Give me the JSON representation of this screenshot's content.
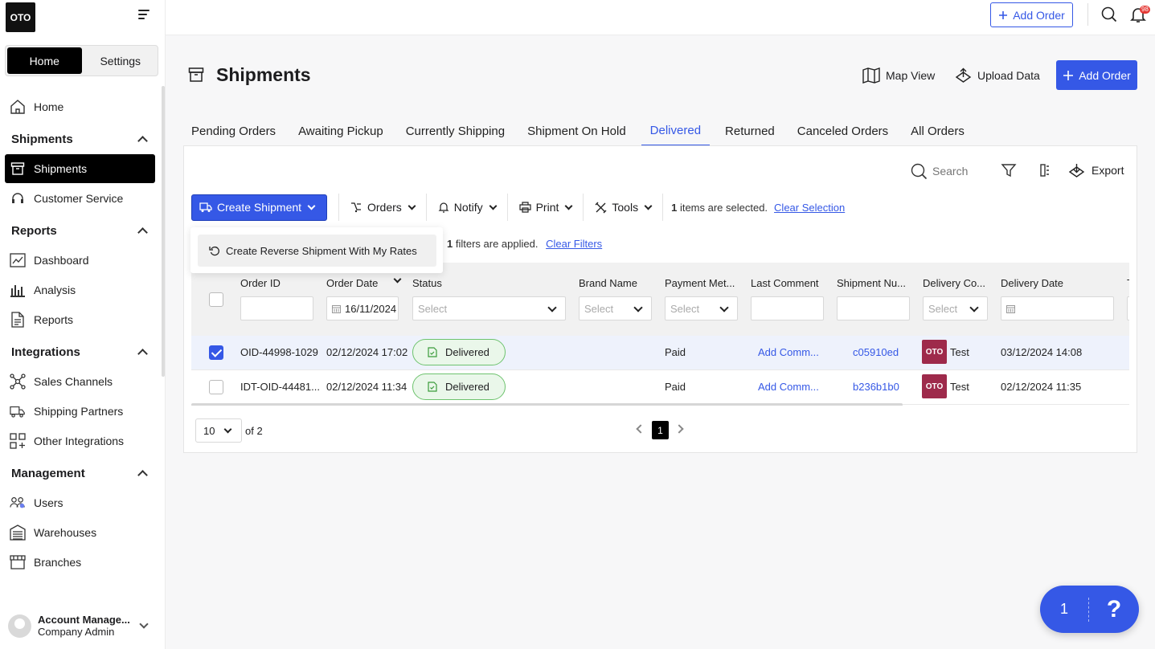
{
  "app": {
    "logo_text": "OTO"
  },
  "sidebar": {
    "segment": {
      "home": "Home",
      "settings": "Settings"
    },
    "items": [
      {
        "type": "item",
        "label": "Home",
        "icon": "house-icon"
      },
      {
        "type": "head",
        "label": "Shipments"
      },
      {
        "type": "item",
        "label": "Shipments",
        "icon": "box-icon",
        "active": true
      },
      {
        "type": "item",
        "label": "Customer Service",
        "icon": "headset-icon"
      },
      {
        "type": "head",
        "label": "Reports"
      },
      {
        "type": "item",
        "label": "Dashboard",
        "icon": "dashboard-icon"
      },
      {
        "type": "item",
        "label": "Analysis",
        "icon": "bar-chart-icon"
      },
      {
        "type": "item",
        "label": "Reports",
        "icon": "document-icon"
      },
      {
        "type": "head",
        "label": "Integrations"
      },
      {
        "type": "item",
        "label": "Sales Channels",
        "icon": "network-icon"
      },
      {
        "type": "item",
        "label": "Shipping Partners",
        "icon": "truck-icon"
      },
      {
        "type": "item",
        "label": "Other Integrations",
        "icon": "grid-plus-icon"
      },
      {
        "type": "head",
        "label": "Management"
      },
      {
        "type": "item",
        "label": "Users",
        "icon": "users-icon"
      },
      {
        "type": "item",
        "label": "Warehouses",
        "icon": "warehouse-icon"
      },
      {
        "type": "item",
        "label": "Branches",
        "icon": "store-icon"
      }
    ],
    "account": {
      "name": "Account Manage...",
      "role": "Company Admin"
    }
  },
  "topbar": {
    "add_order": "Add Order",
    "notification_count": "98"
  },
  "page": {
    "title": "Shipments",
    "map_view": "Map View",
    "upload_data": "Upload Data",
    "add_order": "Add Order"
  },
  "tabs": [
    {
      "label": "Pending Orders"
    },
    {
      "label": "Awaiting Pickup"
    },
    {
      "label": "Currently Shipping"
    },
    {
      "label": "Shipment On Hold"
    },
    {
      "label": "Delivered",
      "active": true
    },
    {
      "label": "Returned"
    },
    {
      "label": "Canceled Orders"
    },
    {
      "label": "All Orders"
    }
  ],
  "card": {
    "search_placeholder": "Search",
    "export": "Export",
    "toolbar": {
      "create_shipment": "Create Shipment",
      "orders": "Orders",
      "notify": "Notify",
      "print": "Print",
      "tools": "Tools",
      "selected_count": "1",
      "selected_text": "items are selected.",
      "clear_selection": "Clear Selection"
    },
    "dropdown_item": "Create Reverse Shipment With My Rates",
    "filters_count": "1",
    "filters_text": "filters are applied.",
    "clear_filters": "Clear Filters"
  },
  "table": {
    "columns": [
      "Order ID",
      "Order Date",
      "Status",
      "Brand Name",
      "Payment Met...",
      "Last Comment",
      "Shipment Nu...",
      "Delivery Co...",
      "Delivery Date",
      "T"
    ],
    "filters": {
      "order_date": "16/11/2024",
      "select": "Select"
    },
    "rows": [
      {
        "checked": true,
        "order_id": "OID-44998-1029",
        "order_date": "02/12/2024 17:02",
        "status": "Delivered",
        "payment": "Paid",
        "comment": "Add Comm...",
        "shipment_no": "c05910ed",
        "company_logo": "OTO",
        "company": "Test",
        "delivery_date": "03/12/2024 14:08"
      },
      {
        "checked": false,
        "order_id": "IDT-OID-44481...",
        "order_date": "02/12/2024 11:34",
        "status": "Delivered",
        "payment": "Paid",
        "comment": "Add Comm...",
        "shipment_no": "b236b1b0",
        "company_logo": "OTO",
        "company": "Test",
        "delivery_date": "02/12/2024 11:35"
      }
    ]
  },
  "pagination": {
    "page_size": "10",
    "of_text": "of 2",
    "current": "1"
  },
  "help": {
    "count": "1",
    "symbol": "?"
  },
  "colors": {
    "accent": "#3558e6",
    "status_green": "#6ec36e",
    "brand_badge": "#9e2a4b"
  }
}
